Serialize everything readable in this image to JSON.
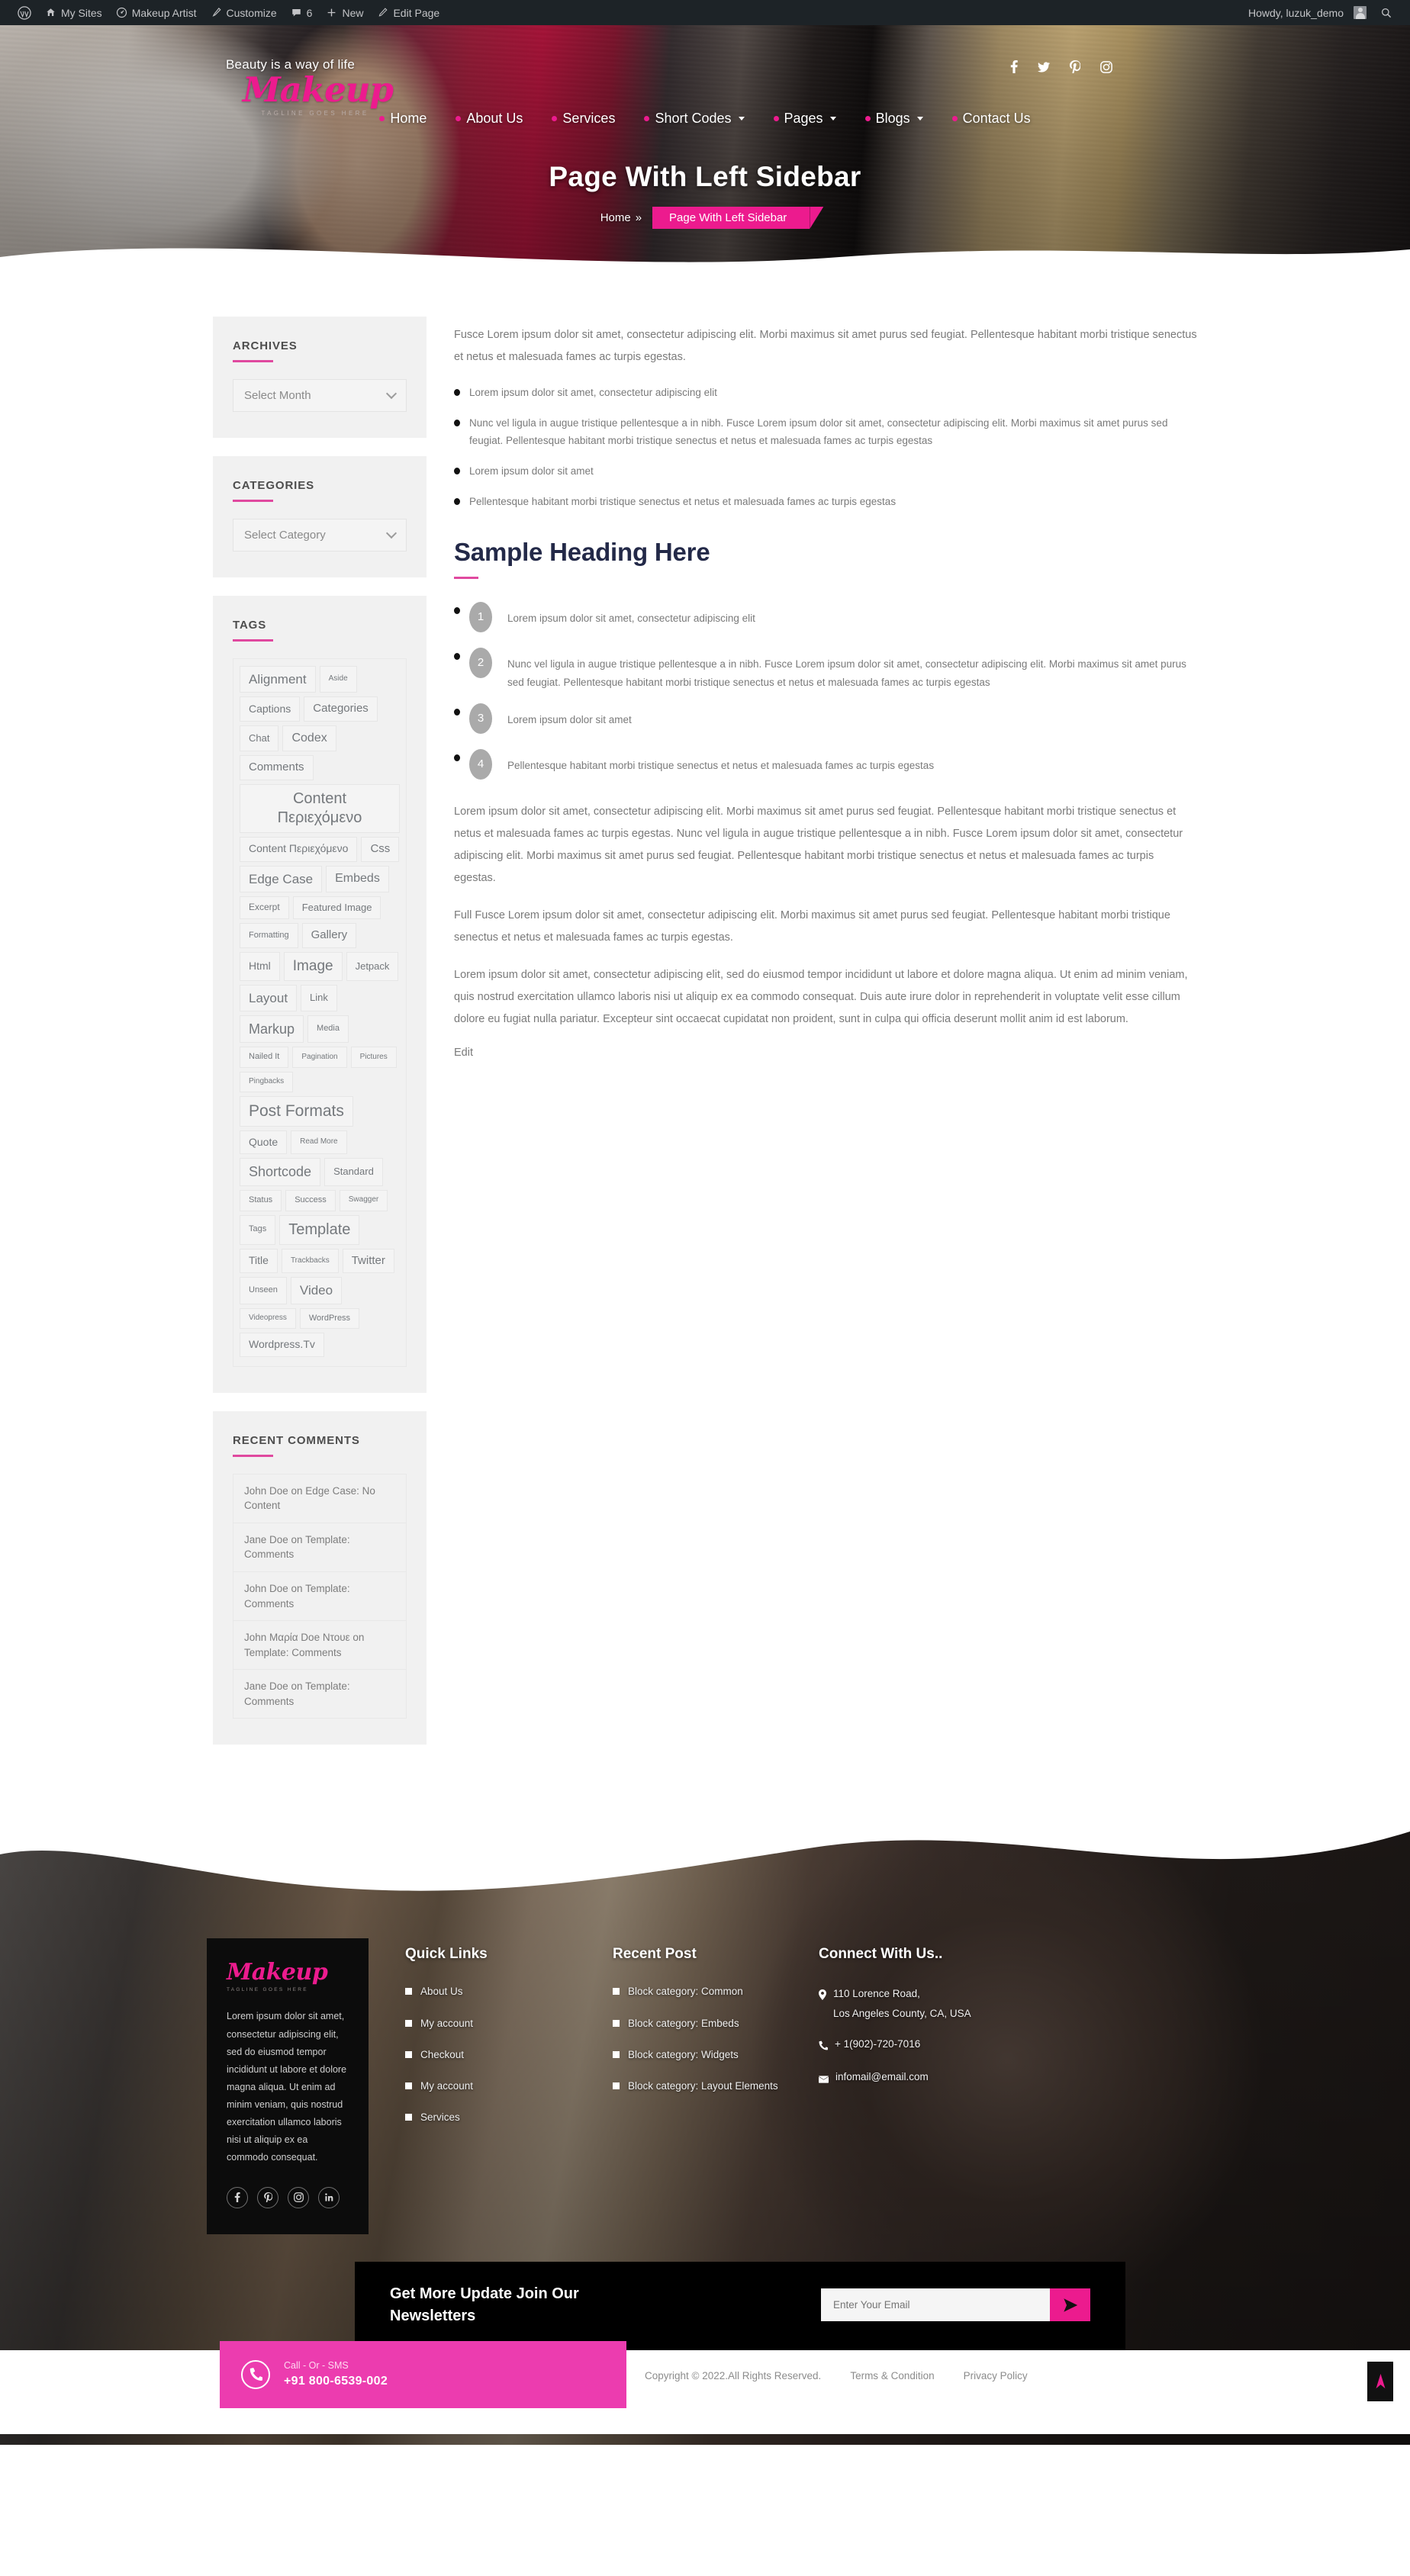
{
  "adminbar": {
    "left_items": [
      {
        "label": "",
        "icon": "wordpress-icon"
      },
      {
        "label": "My Sites",
        "icon": "sites-icon"
      },
      {
        "label": "Makeup Artist",
        "icon": "dashboard-icon"
      },
      {
        "label": "Customize",
        "icon": "brush-icon"
      },
      {
        "label": "6",
        "icon": "comment-icon"
      },
      {
        "label": "New",
        "icon": "plus-icon"
      },
      {
        "label": "Edit Page",
        "icon": "pencil-icon"
      }
    ],
    "howdy": "Howdy, luzuk_demo",
    "search_icon": "search-icon"
  },
  "header": {
    "tagline": "Beauty is a way of life",
    "logo": "Makeup",
    "logo_sub": "TAGLINE GOES HERE",
    "social": [
      "facebook-icon",
      "twitter-icon",
      "pinterest-icon",
      "instagram-icon"
    ],
    "nav": [
      {
        "label": "Home",
        "has_caret": false
      },
      {
        "label": "About Us",
        "has_caret": false
      },
      {
        "label": "Services",
        "has_caret": false
      },
      {
        "label": "Short Codes",
        "has_caret": true
      },
      {
        "label": "Pages",
        "has_caret": true
      },
      {
        "label": "Blogs",
        "has_caret": true
      },
      {
        "label": "Contact Us",
        "has_caret": false
      }
    ],
    "page_title": "Page With Left Sidebar",
    "breadcrumb": {
      "home": "Home",
      "separator": "»",
      "current": "Page With Left Sidebar"
    }
  },
  "sidebar": {
    "archives": {
      "title": "ARCHIVES",
      "select_value": "Select Month"
    },
    "categories": {
      "title": "CATEGORIES",
      "select_value": "Select Category"
    },
    "tags": {
      "title": "TAGS",
      "items": [
        {
          "label": "Alignment",
          "size": 17
        },
        {
          "label": "Aside",
          "size": 10
        },
        {
          "label": "Captions",
          "size": 14
        },
        {
          "label": "Categories",
          "size": 15
        },
        {
          "label": "Chat",
          "size": 13
        },
        {
          "label": "Codex",
          "size": 16
        },
        {
          "label": "Comments",
          "size": 15
        },
        {
          "label": "Content Περιεχόμενο",
          "size": 20
        },
        {
          "label": "Content Περιεχόμενο",
          "size": 14
        },
        {
          "label": "Css",
          "size": 15
        },
        {
          "label": "Edge Case",
          "size": 17
        },
        {
          "label": "Embeds",
          "size": 16
        },
        {
          "label": "Excerpt",
          "size": 12
        },
        {
          "label": "Featured Image",
          "size": 13
        },
        {
          "label": "Formatting",
          "size": 11
        },
        {
          "label": "Gallery",
          "size": 15
        },
        {
          "label": "Html",
          "size": 14
        },
        {
          "label": "Image",
          "size": 19
        },
        {
          "label": "Jetpack",
          "size": 13
        },
        {
          "label": "Layout",
          "size": 17
        },
        {
          "label": "Link",
          "size": 13
        },
        {
          "label": "Markup",
          "size": 18
        },
        {
          "label": "Media",
          "size": 11
        },
        {
          "label": "Nailed It",
          "size": 11
        },
        {
          "label": "Pagination",
          "size": 10
        },
        {
          "label": "Pictures",
          "size": 10
        },
        {
          "label": "Pingbacks",
          "size": 10
        },
        {
          "label": "Post Formats",
          "size": 21
        },
        {
          "label": "Quote",
          "size": 14
        },
        {
          "label": "Read More",
          "size": 10
        },
        {
          "label": "Shortcode",
          "size": 18
        },
        {
          "label": "Standard",
          "size": 13
        },
        {
          "label": "Status",
          "size": 11
        },
        {
          "label": "Success",
          "size": 11
        },
        {
          "label": "Swagger",
          "size": 10
        },
        {
          "label": "Tags",
          "size": 11
        },
        {
          "label": "Template",
          "size": 20
        },
        {
          "label": "Title",
          "size": 14
        },
        {
          "label": "Trackbacks",
          "size": 10
        },
        {
          "label": "Twitter",
          "size": 15
        },
        {
          "label": "Unseen",
          "size": 11
        },
        {
          "label": "Video",
          "size": 17
        },
        {
          "label": "Videopress",
          "size": 10
        },
        {
          "label": "WordPress",
          "size": 11
        },
        {
          "label": "Wordpress.Tv",
          "size": 14
        }
      ]
    },
    "recent_comments": {
      "title": "RECENT COMMENTS",
      "items": [
        "John Doe on Edge Case: No Content",
        "Jane Doe on Template: Comments",
        "John Doe on Template: Comments",
        "John Μαρία Doe Ντουε on Template: Comments",
        "Jane Doe on Template: Comments"
      ]
    }
  },
  "main": {
    "intro": "Fusce Lorem ipsum dolor sit amet, consectetur adipiscing elit. Morbi maximus sit amet purus sed feugiat. Pellentesque habitant morbi tristique senectus et netus et malesuada fames ac turpis egestas.",
    "bullets": [
      "Lorem ipsum dolor sit amet, consectetur adipiscing elit",
      "Nunc vel ligula in augue tristique pellentesque a in nibh. Fusce Lorem ipsum dolor sit amet, consectetur adipiscing elit. Morbi maximus sit amet purus sed feugiat. Pellentesque habitant morbi tristique senectus et netus et malesuada fames ac turpis egestas",
      "Lorem ipsum dolor sit amet",
      "Pellentesque habitant morbi tristique senectus et netus et malesuada fames ac turpis egestas"
    ],
    "heading": "Sample Heading Here",
    "numbered": [
      {
        "num": "1",
        "text": "Lorem ipsum dolor sit amet, consectetur adipiscing elit"
      },
      {
        "num": "2",
        "text": "Nunc vel ligula in augue tristique pellentesque a in nibh. Fusce Lorem ipsum dolor sit amet, consectetur adipiscing elit. Morbi maximus sit amet purus sed feugiat. Pellentesque habitant morbi tristique senectus et netus et malesuada fames ac turpis egestas"
      },
      {
        "num": "3",
        "text": "Lorem ipsum dolor sit amet"
      },
      {
        "num": "4",
        "text": "Pellentesque habitant morbi tristique senectus et netus et malesuada fames ac turpis egestas"
      }
    ],
    "para1": "Lorem ipsum dolor sit amet, consectetur adipiscing elit. Morbi maximus sit amet purus sed feugiat. Pellentesque habitant morbi tristique senectus et netus et malesuada fames ac turpis egestas. Nunc vel ligula in augue tristique pellentesque a in nibh. Fusce Lorem ipsum dolor sit amet, consectetur adipiscing elit. Morbi maximus sit amet purus sed feugiat. Pellentesque habitant morbi tristique senectus et netus et malesuada fames ac turpis egestas.",
    "para2": "Full Fusce Lorem ipsum dolor sit amet, consectetur adipiscing elit. Morbi maximus sit amet purus sed feugiat. Pellentesque habitant morbi tristique senectus et netus et malesuada fames ac turpis egestas.",
    "para3": "Lorem ipsum dolor sit amet, consectetur adipiscing elit, sed do eiusmod tempor incididunt ut labore et dolore magna aliqua. Ut enim ad minim veniam, quis nostrud exercitation ullamco laboris nisi ut aliquip ex ea commodo consequat. Duis aute irure dolor in reprehenderit in voluptate velit esse cillum dolore eu fugiat nulla pariatur. Excepteur sint occaecat cupidatat non proident, sunt in culpa qui officia deserunt mollit anim id est laborum.",
    "edit": "Edit"
  },
  "footer": {
    "about": {
      "logo": "Makeup",
      "logo_sub": "TAGLINE GOES HERE",
      "text": "Lorem ipsum dolor sit amet, consectetur adipiscing elit, sed do eiusmod tempor incididunt ut labore et dolore magna aliqua. Ut enim ad minim veniam, quis nostrud exercitation ullamco laboris nisi ut aliquip ex ea commodo consequat.",
      "social": [
        "facebook-icon",
        "pinterest-icon",
        "instagram-icon",
        "linkedin-icon"
      ]
    },
    "quick_links": {
      "title": "Quick Links",
      "items": [
        "About Us",
        "My account",
        "Checkout",
        "My account",
        "Services"
      ]
    },
    "recent_post": {
      "title": "Recent Post",
      "items": [
        "Block category: Common",
        "Block category: Embeds",
        "Block category: Widgets",
        "Block category: Layout Elements"
      ]
    },
    "connect": {
      "title": "Connect With Us..",
      "address_line1": "110 Lorence Road,",
      "address_line2": "Los Angeles County, CA, USA",
      "phone": "+ 1(902)-720-7016",
      "email": "infomail@email.com"
    },
    "newsletter": {
      "title": "Get More Update Join Our Newsletters",
      "placeholder": "Enter Your Email",
      "submit_icon": "send-icon"
    },
    "callbox": {
      "label": "Call - Or - SMS",
      "number": "+91 800-6539-002",
      "icon": "phone-icon"
    },
    "copyright": "Copyright © 2022.All Rights Reserved.",
    "links": [
      "Terms & Condition",
      "Privacy Policy"
    ],
    "to_top_icon": "arrow-up-icon"
  },
  "colors": {
    "accent": "#ec1b8e",
    "accent_light": "#ec3caf",
    "heading": "#232948",
    "admin_bar": "#1d2327"
  }
}
